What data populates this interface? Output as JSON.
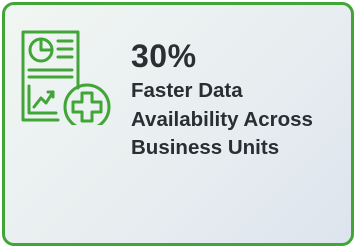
{
  "stat": {
    "value": "30%",
    "description": "Faster Data Availability Across Business Units"
  },
  "icon": {
    "name": "report-chart-plus-icon",
    "color": "#41a537"
  },
  "colors": {
    "border": "#41a537",
    "text": "#2b2f33"
  }
}
